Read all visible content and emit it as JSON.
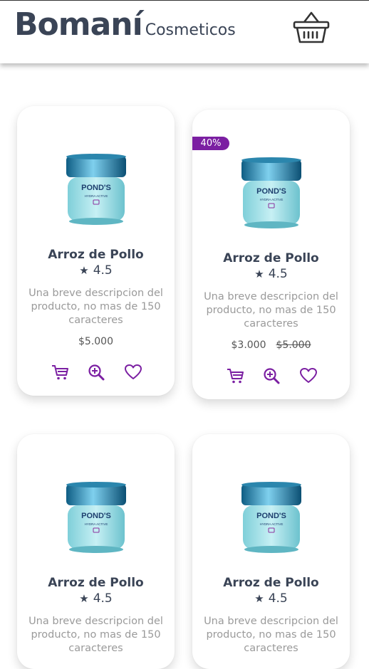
{
  "brand": {
    "name": "Bomaní",
    "subtitle": "Cosmeticos"
  },
  "colors": {
    "accent": "#7b1fa2",
    "text": "#3a4456",
    "muted": "#9a9a9a"
  },
  "products": [
    {
      "title": "Arroz de Pollo",
      "rating": "4.5",
      "description": "Una breve descripcion del producto, no mas de 150 caracteres",
      "price": "$5.000"
    },
    {
      "title": "Arroz de Pollo",
      "rating": "4.5",
      "description": "Una breve descripcion del producto, no mas de 150 caracteres",
      "price": "$3.000",
      "old_price": "$5.000",
      "discount": "40%"
    },
    {
      "title": "Arroz de Pollo",
      "rating": "4.5",
      "description": "Una breve descripcion del producto, no mas de 150 caracteres"
    },
    {
      "title": "Arroz de Pollo",
      "rating": "4.5",
      "description": "Una breve descripcion del producto, no mas de 150 caracteres"
    }
  ]
}
